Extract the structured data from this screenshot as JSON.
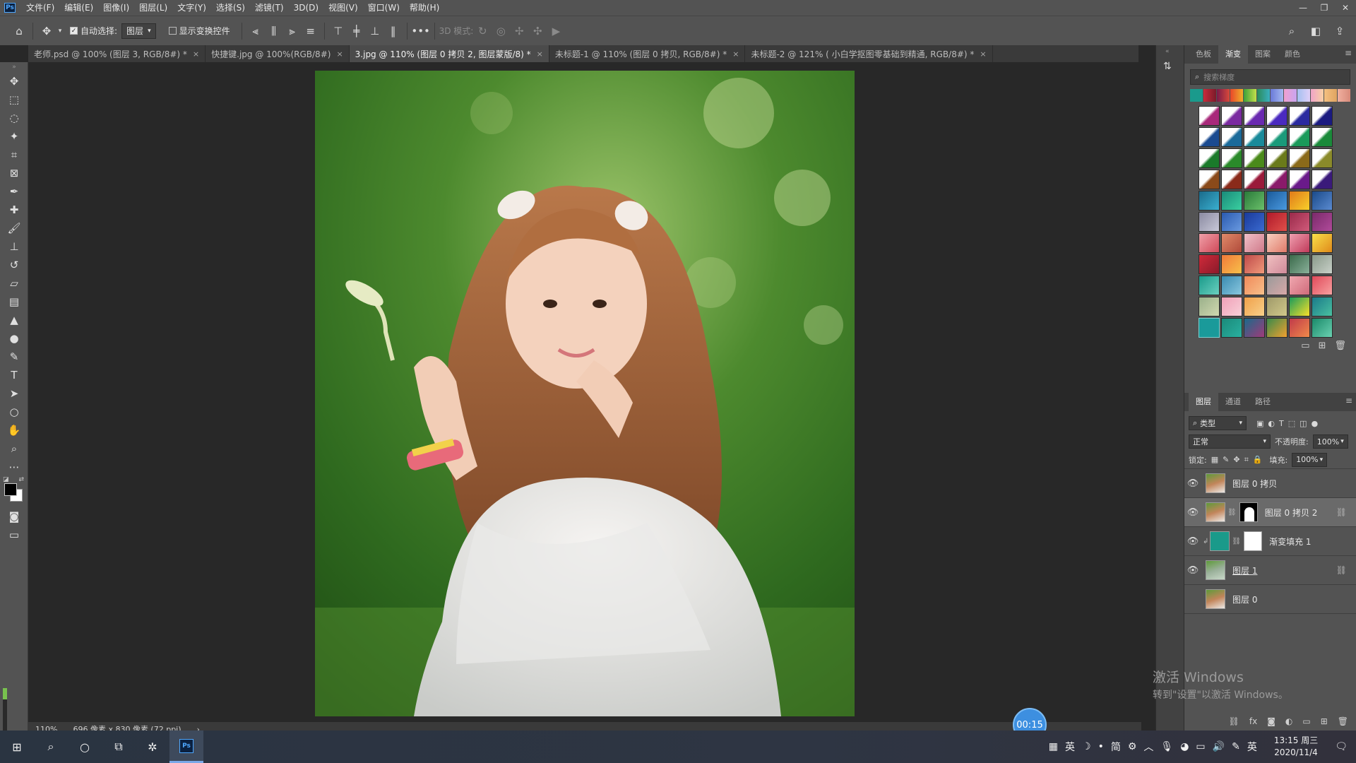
{
  "app": {
    "logo": "Ps"
  },
  "menu": [
    "文件(F)",
    "编辑(E)",
    "图像(I)",
    "图层(L)",
    "文字(Y)",
    "选择(S)",
    "滤镜(T)",
    "3D(D)",
    "视图(V)",
    "窗口(W)",
    "帮助(H)"
  ],
  "options": {
    "auto_select_label": "自动选择:",
    "auto_select_value": "图层",
    "show_transform_label": "显示变换控件",
    "mode_3d_label": "3D 模式:",
    "more": "•••"
  },
  "tabs": [
    {
      "label": "老师.psd @ 100% (图层 3, RGB/8#) *",
      "close": "×"
    },
    {
      "label": "快捷键.jpg @ 100%(RGB/8#)",
      "close": "×"
    },
    {
      "label": "3.jpg @ 110% (图层 0 拷贝 2, 图层蒙版/8) *",
      "close": "×"
    },
    {
      "label": "未标题-1 @ 110% (图层 0 拷贝, RGB/8#) *",
      "close": "×"
    },
    {
      "label": "未标题-2 @ 121% ( 小白学抠图零基础到精通, RGB/8#) *",
      "close": "×"
    }
  ],
  "status": {
    "zoom": "110%",
    "doc_size": "696 像素 x 830 像素 (72 ppi)",
    "arrow": "›"
  },
  "timer": "00:15",
  "gradient_panel": {
    "tabs": [
      "色板",
      "渐变",
      "图案",
      "颜色"
    ],
    "search_placeholder": "搜索梯度"
  },
  "layers_panel": {
    "tabs": [
      "图层",
      "通道",
      "路径"
    ],
    "filter_label": "类型",
    "blend_mode": "正常",
    "opacity_label": "不透明度:",
    "opacity_value": "100%",
    "lock_label": "锁定:",
    "fill_label": "填充:",
    "fill_value": "100%",
    "layers": [
      {
        "name": "图层 0 拷贝",
        "visible": true
      },
      {
        "name": "图层 0 拷贝 2",
        "visible": true
      },
      {
        "name": "渐变填充 1",
        "visible": true
      },
      {
        "name": "图层 1",
        "visible": true
      },
      {
        "name": "图层 0",
        "visible": false
      }
    ]
  },
  "watermark": {
    "title": "激活 Windows",
    "subtitle": "转到\"设置\"以激活 Windows。"
  },
  "taskbar": {
    "tray_text": [
      "英",
      "简",
      "英"
    ],
    "time": "13:15 周三",
    "date": "2020/11/4"
  },
  "colors": {
    "accent": "#3d8fe0",
    "panel_bg": "#535353",
    "canvas_bg": "#282828",
    "selected_layer": "#6a6a6a"
  }
}
